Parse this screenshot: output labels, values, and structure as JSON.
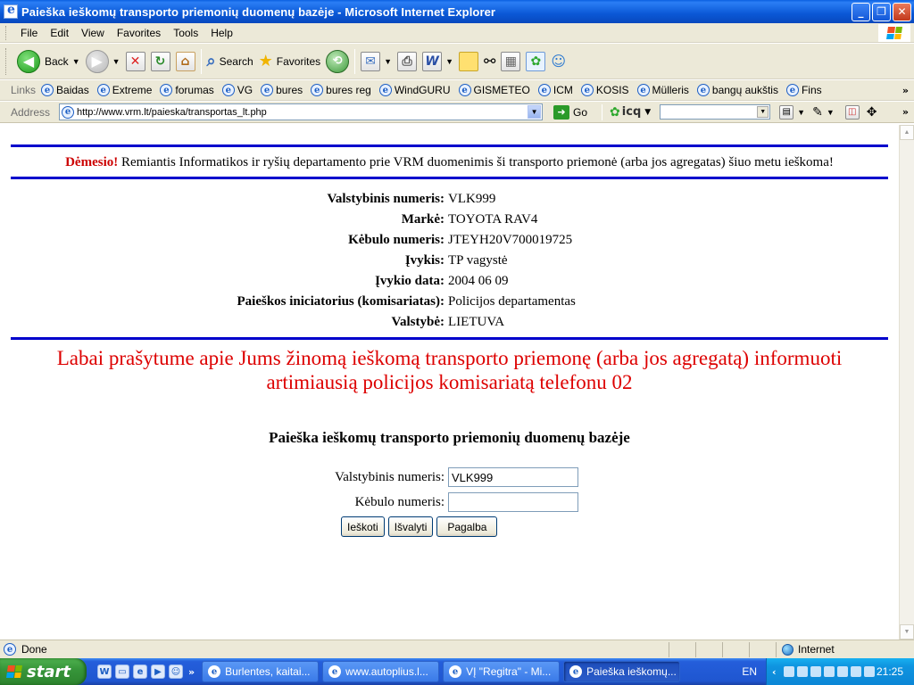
{
  "window": {
    "title": "Paieška ieškomų transporto priemonių duomenų bazėje - Microsoft Internet Explorer",
    "minimize": "_",
    "maximize": "❐",
    "close": "✕"
  },
  "menu": [
    "File",
    "Edit",
    "View",
    "Favorites",
    "Tools",
    "Help"
  ],
  "toolbar": {
    "back_label": "Back",
    "search_label": "Search",
    "favorites_label": "Favorites"
  },
  "links": {
    "label": "Links",
    "items": [
      "Baidas",
      "Extreme",
      "forumas",
      "VG",
      "bures",
      "bures reg",
      "WindGURU",
      "GISMETEO",
      "ICM",
      "KOSIS",
      "Mülleris",
      "bangų aukštis",
      "Fins"
    ]
  },
  "address": {
    "label": "Address",
    "url": "http://www.vrm.lt/paieska/transportas_lt.php",
    "go_label": "Go",
    "icq_label": "icq"
  },
  "page": {
    "notice_warn": "Dėmesio!",
    "notice_text": " Remiantis Informatikos ir ryšių departamento prie VRM duomenimis ši transporto priemonė (arba jos agregatas) šiuo metu ieškoma!",
    "details": [
      {
        "label": "Valstybinis numeris:",
        "value": "VLK999"
      },
      {
        "label": "Markė:",
        "value": "TOYOTA RAV4"
      },
      {
        "label": "Kėbulo numeris:",
        "value": "JTEYH20V700019725"
      },
      {
        "label": "Įvykis:",
        "value": "TP vagystė"
      },
      {
        "label": "Įvykio data:",
        "value": "2004 06 09"
      },
      {
        "label": "Paieškos iniciatorius (komisariatas):",
        "value": "Policijos departamentas"
      },
      {
        "label": "Valstybė:",
        "value": "LIETUVA"
      }
    ],
    "appeal_line1": "Labai prašytume apie Jums žinomą ieškomą transporto priemonę (arba jos agregatą) informuoti",
    "appeal_line2": "artimiausią policijos komisariatą telefonu 02",
    "search_title": "Paieška ieškomų transporto priemonių duomenų bazėje",
    "form": {
      "plate_label": "Valstybinis numeris:",
      "plate_value": "VLK999",
      "body_label": "Kėbulo numeris:",
      "body_value": ""
    },
    "buttons": {
      "search": "Ieškoti",
      "clear": "Išvalyti",
      "help": "Pagalba"
    }
  },
  "status": {
    "text": "Done",
    "zone": "Internet"
  },
  "taskbar": {
    "start": "start",
    "tasks": [
      {
        "label": "Burlentes, kaitai...",
        "active": false
      },
      {
        "label": "www.autoplius.l...",
        "active": false
      },
      {
        "label": "VĮ \"Regitra\" - Mi...",
        "active": false
      },
      {
        "label": "Paieška ieškomų...",
        "active": true
      }
    ],
    "lang": "EN",
    "clock": "21:25"
  }
}
